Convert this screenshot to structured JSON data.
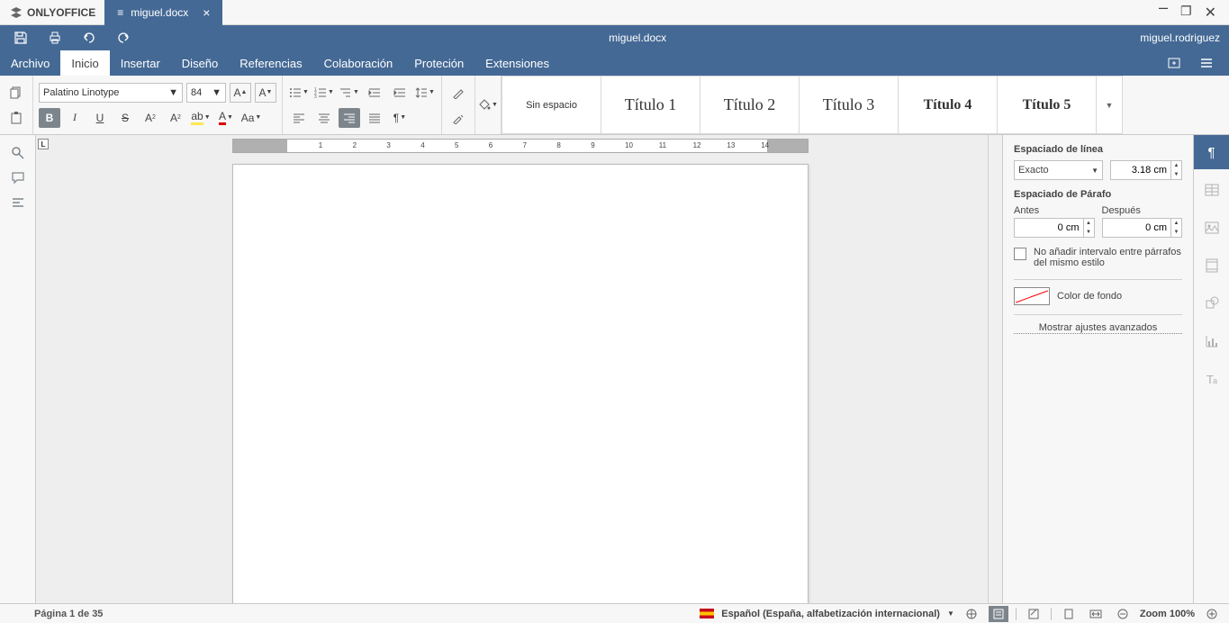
{
  "app_name": "ONLYOFFICE",
  "document_tab": "miguel.docx",
  "document_title": "miguel.docx",
  "user_name": "miguel.rodriguez",
  "menu_tabs": [
    "Archivo",
    "Inicio",
    "Insertar",
    "Diseño",
    "Referencias",
    "Colaboración",
    "Proteción",
    "Extensiones"
  ],
  "active_tab": "Inicio",
  "font_name": "Palatino Linotype",
  "font_size": "84",
  "styles": [
    "Sin espacio",
    "Título 1",
    "Título 2",
    "Título 3",
    "Título 4",
    "Título 5"
  ],
  "right_panel": {
    "line_spacing_title": "Espaciado de línea",
    "spacing_mode": "Exacto",
    "spacing_value": "3.18 cm",
    "para_spacing_title": "Espaciado de Párafo",
    "before_label": "Antes",
    "after_label": "Después",
    "before_value": "0 cm",
    "after_value": "0 cm",
    "no_interval_checkbox": "No añadir intervalo entre párrafos del mismo estilo",
    "bg_color_label": "Color de fondo",
    "advanced_link": "Mostrar ajustes avanzados"
  },
  "statusbar": {
    "page_info": "Página 1 de 35",
    "language": "Español (España, alfabetización internacional)",
    "zoom": "Zoom 100%"
  },
  "ruler_numbers": [
    "1",
    "2",
    "3",
    "4",
    "5",
    "6",
    "7",
    "8",
    "9",
    "10",
    "11",
    "12",
    "13",
    "14"
  ]
}
